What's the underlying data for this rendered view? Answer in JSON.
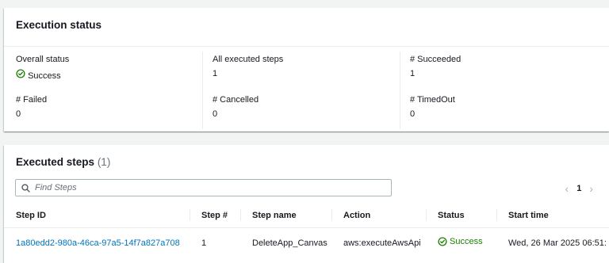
{
  "execution_status": {
    "title": "Execution status",
    "fields": [
      {
        "label": "Overall status",
        "value": "Success"
      },
      {
        "label": "All executed steps",
        "value": "1"
      },
      {
        "label": "# Succeeded",
        "value": "1"
      },
      {
        "label": "# Failed",
        "value": "0"
      },
      {
        "label": "# Cancelled",
        "value": "0"
      },
      {
        "label": "# TimedOut",
        "value": "0"
      }
    ]
  },
  "executed_steps": {
    "title": "Executed steps",
    "count": "(1)",
    "search_placeholder": "Find Steps",
    "current_page": "1",
    "columns": [
      "Step ID",
      "Step #",
      "Step name",
      "Action",
      "Status",
      "Start time"
    ],
    "rows": [
      {
        "step_id": "1a80edd2-980a-46ca-97a5-14f7a827a708",
        "step_num": "1",
        "step_name": "DeleteApp_Canvas",
        "action": "aws:executeAwsApi",
        "status": "Success",
        "start_time": "Wed, 26 Mar 2025 06:51:"
      }
    ]
  },
  "colors": {
    "success": "#1d8102",
    "link": "#0073bb",
    "background": "#f2f3f3"
  },
  "icons": {
    "status_success": "check-circle-icon",
    "search": "search-icon",
    "pager_prev": "chevron-left-icon",
    "pager_next": "chevron-right-icon"
  }
}
